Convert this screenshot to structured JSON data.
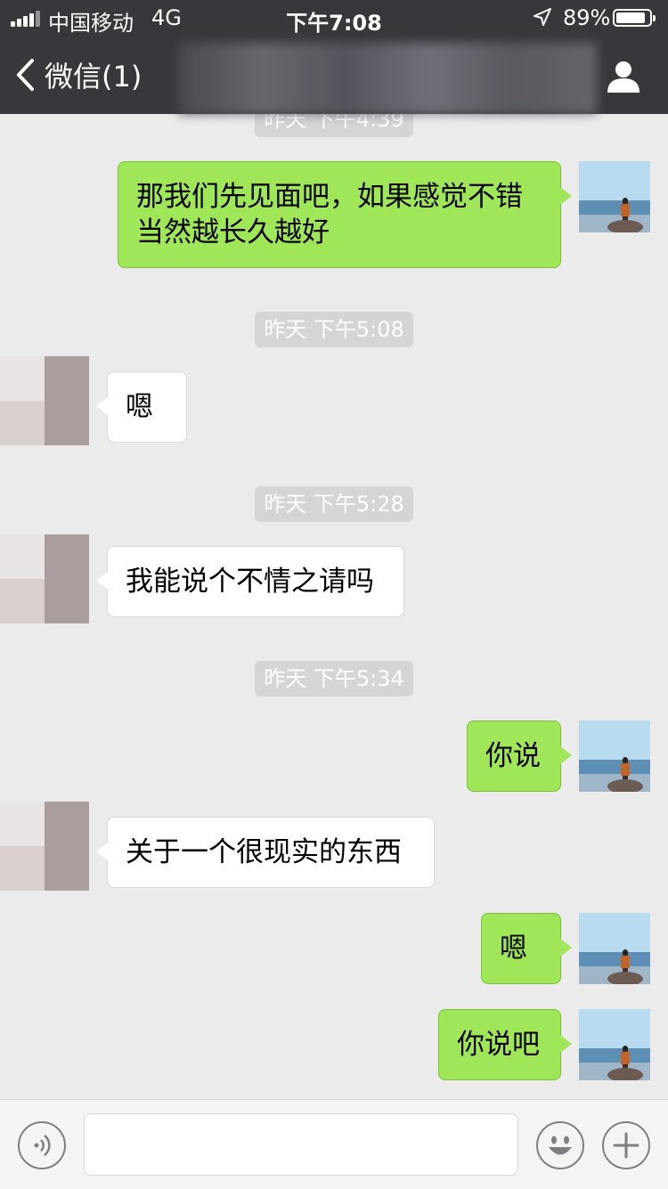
{
  "status_bar": {
    "carrier": "中国移动",
    "network": "4G",
    "time": "下午7:08",
    "battery_percent": "89%",
    "battery_level": 0.89
  },
  "nav": {
    "back_label": "微信(1)"
  },
  "timestamps": [
    "昨天 下午4:39",
    "昨天 下午5:08",
    "昨天 下午5:28",
    "昨天 下午5:34"
  ],
  "messages": [
    {
      "from": "me",
      "lines": [
        "那我们先见面吧，如果感觉不错",
        "当然越长久越好"
      ]
    },
    {
      "from": "other",
      "text": "嗯"
    },
    {
      "from": "other",
      "text": "我能说个不情之请吗"
    },
    {
      "from": "me",
      "text": "你说"
    },
    {
      "from": "other",
      "text": "关于一个很现实的东西"
    },
    {
      "from": "me",
      "text": "嗯"
    },
    {
      "from": "me",
      "text": "你说吧"
    }
  ],
  "icons": {
    "back": "chevron-left-icon",
    "profile": "person-icon",
    "voice": "voice-icon",
    "emoji": "smiley-icon",
    "more": "plus-icon"
  },
  "colors": {
    "nav_bg": "#37373c",
    "chat_bg": "#ebebeb",
    "my_bubble": "#9fe658",
    "other_bubble": "#ffffff",
    "timestamp_bg": "#d5d5d5"
  }
}
